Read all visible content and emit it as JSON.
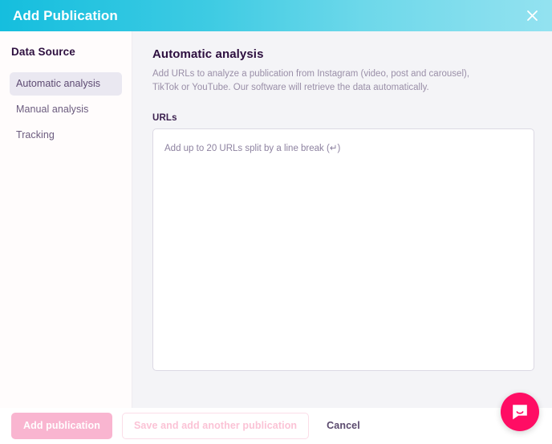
{
  "header": {
    "title": "Add Publication",
    "close_icon": "close-icon",
    "gradient_from": "#15bede",
    "gradient_to": "#93e2f0"
  },
  "sidebar": {
    "heading": "Data Source",
    "items": [
      {
        "label": "Automatic analysis",
        "active": true
      },
      {
        "label": "Manual analysis",
        "active": false
      },
      {
        "label": "Tracking",
        "active": false
      }
    ]
  },
  "main": {
    "title": "Automatic analysis",
    "description": "Add URLs to analyze a publication from Instagram (video, post and carousel), TikTok or YouTube. Our software will retrieve the data automatically.",
    "urls_label": "URLs",
    "urls_value": "",
    "urls_placeholder": "Add up to 20 URLs split by a line break (↵)"
  },
  "footer": {
    "primary_label": "Add publication",
    "secondary_label": "Save and add another publication",
    "cancel_label": "Cancel",
    "primary_color": "#f9b5d0",
    "secondary_color": "#fbc3d6"
  },
  "chat": {
    "launcher_icon": "chat-bubble-icon",
    "launcher_color": "#ff0d64"
  }
}
